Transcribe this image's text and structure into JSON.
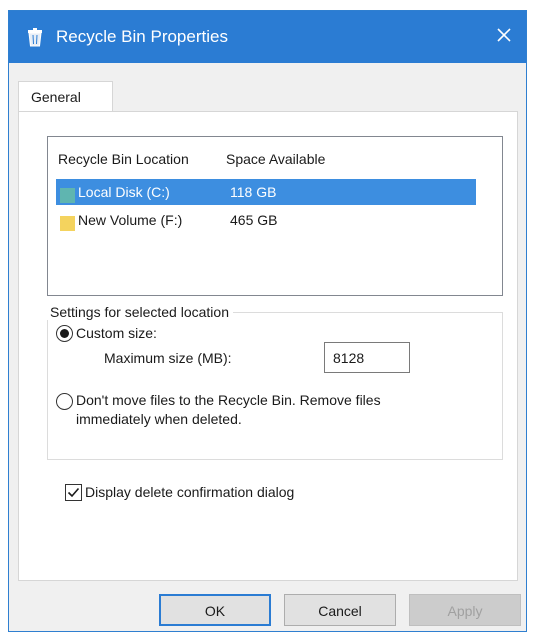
{
  "window": {
    "title": "Recycle Bin Properties",
    "title_icon": "recycle-bin-icon",
    "close_icon": "close-icon",
    "accent_color": "#2b7cd3"
  },
  "tabs": [
    {
      "label": "General",
      "active": true
    }
  ],
  "location_list": {
    "columns": [
      "Recycle Bin Location",
      "Space Available"
    ],
    "rows": [
      {
        "name": "Local Disk (C:)",
        "space": "118 GB",
        "selected": true,
        "icon": "drive-icon",
        "icon_color": "#5fb5b0"
      },
      {
        "name": "New Volume (F:)",
        "space": "465 GB",
        "selected": false,
        "icon": "drive-icon",
        "icon_color": "#f4d35e"
      }
    ],
    "selection_color": "#3d8ee0"
  },
  "settings": {
    "group_label": "Settings for selected location",
    "custom_size_label": "Custom size:",
    "custom_size_selected": true,
    "max_size_label": "Maximum size (MB):",
    "max_size_value": "8128",
    "dont_move_line1": "Don't move files to the Recycle Bin. Remove files",
    "dont_move_line2": "immediately when deleted.",
    "dont_move_selected": false
  },
  "confirm": {
    "label": "Display delete confirmation dialog",
    "checked": true
  },
  "buttons": {
    "ok": "OK",
    "cancel": "Cancel",
    "apply": "Apply",
    "apply_enabled": false
  }
}
